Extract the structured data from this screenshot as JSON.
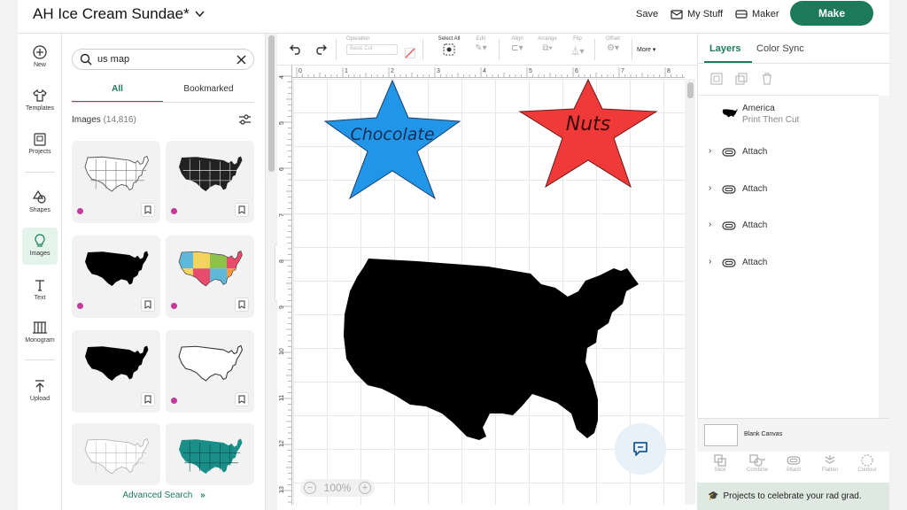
{
  "header": {
    "project_title": "AH Ice Cream Sundae*",
    "save_label": "Save",
    "my_stuff_label": "My Stuff",
    "maker_label": "Maker",
    "make_label": "Make"
  },
  "rail": {
    "items": [
      {
        "label": "New",
        "icon": "plus-circle-icon"
      },
      {
        "label": "Templates",
        "icon": "shirt-icon"
      },
      {
        "label": "Projects",
        "icon": "projects-icon"
      },
      {
        "label": "Shapes",
        "icon": "shapes-icon"
      },
      {
        "label": "Images",
        "icon": "bulb-icon"
      },
      {
        "label": "Text",
        "icon": "text-icon"
      },
      {
        "label": "Monogram",
        "icon": "monogram-icon"
      },
      {
        "label": "Upload",
        "icon": "upload-icon"
      }
    ]
  },
  "panel": {
    "search_value": "us map",
    "tab_all": "All",
    "tab_bookmarked": "Bookmarked",
    "images_label": "Images",
    "images_count": "(14,816)",
    "advanced_search": "Advanced Search",
    "advanced_chevron": "»"
  },
  "toolbar": {
    "operation_label": "Operation",
    "operation_value": "Basic Cut",
    "select_all_label": "Select All",
    "edit_label": "Edit",
    "align_label": "Align",
    "arrange_label": "Arrange",
    "flip_label": "Flip",
    "offset_label": "Offset",
    "more_label": "More"
  },
  "canvas": {
    "ruler_top_ticks": [
      "0",
      "1",
      "2",
      "3",
      "4",
      "5",
      "6",
      "7",
      "8"
    ],
    "ruler_left_ticks": [
      "4",
      "5",
      "6",
      "7",
      "8",
      "9",
      "10",
      "11",
      "12",
      "13"
    ],
    "star_left_text": "Chocolate",
    "star_right_text": "Nuts",
    "zoom_label": "100%",
    "colors": {
      "star_left": "#2196e8",
      "star_right": "#f03a3a",
      "map": "#000000"
    }
  },
  "right_panel": {
    "tab_layers": "Layers",
    "tab_color_sync": "Color Sync",
    "layers": [
      {
        "name": "America",
        "sub": "Print Then Cut"
      },
      {
        "name": "Attach"
      },
      {
        "name": "Attach"
      },
      {
        "name": "Attach"
      },
      {
        "name": "Attach"
      }
    ],
    "blank_canvas": "Blank Canvas",
    "bottom_tools": [
      "Slice",
      "Combine",
      "Attach",
      "Flatten",
      "Contour"
    ],
    "promo": "Projects to celebrate your rad grad."
  },
  "accent_color": "#1c7a5a"
}
